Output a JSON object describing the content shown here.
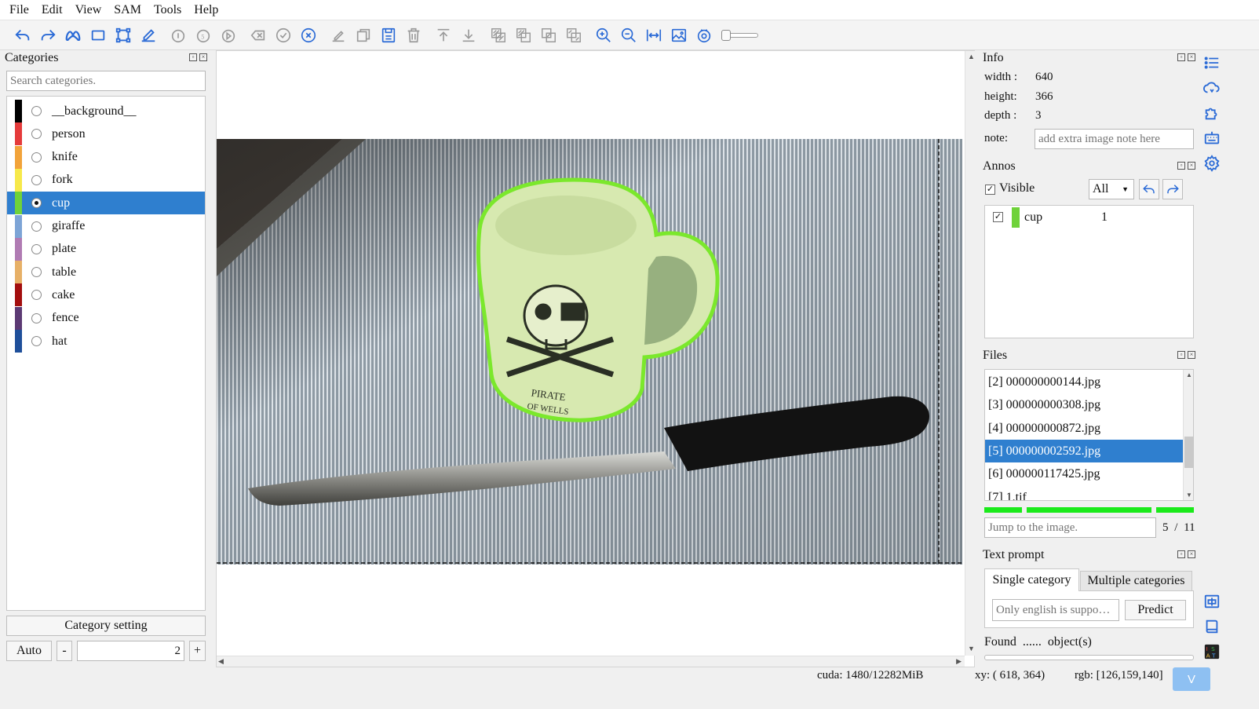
{
  "menu": [
    "File",
    "Edit",
    "View",
    "SAM",
    "Tools",
    "Help"
  ],
  "toolbar": {
    "icons": [
      "undo-icon",
      "redo-icon",
      "sam-icon",
      "rectangle-icon",
      "polygon-icon",
      "line-icon",
      "rotate-icon",
      "rotate-5-icon",
      "play-icon",
      "clear-icon",
      "finish-icon",
      "cancel-icon",
      "edit-icon",
      "copy-icon",
      "save-icon",
      "delete-icon",
      "move-top-icon",
      "move-bottom-icon",
      "union-icon",
      "subtract-icon",
      "intersect-icon",
      "exclude-icon",
      "zoom-in-icon",
      "zoom-out-icon",
      "fit-width-icon",
      "image-icon",
      "eye-icon"
    ],
    "slider_value": 0
  },
  "categories": {
    "title": "Categories",
    "search_placeholder": "Search categories.",
    "items": [
      {
        "label": "__background__",
        "color": "#000000",
        "selected": false
      },
      {
        "label": "person",
        "color": "#e53b3b",
        "selected": false
      },
      {
        "label": "knife",
        "color": "#f2a33a",
        "selected": false
      },
      {
        "label": "fork",
        "color": "#f7e94a",
        "selected": false
      },
      {
        "label": "cup",
        "color": "#6fd23a",
        "selected": true
      },
      {
        "label": "giraffe",
        "color": "#7da4d6",
        "selected": false
      },
      {
        "label": "plate",
        "color": "#b07bb3",
        "selected": false
      },
      {
        "label": "table",
        "color": "#e7b067",
        "selected": false
      },
      {
        "label": "cake",
        "color": "#a30e0e",
        "selected": false
      },
      {
        "label": "fence",
        "color": "#5c3a74",
        "selected": false
      },
      {
        "label": "hat",
        "color": "#1f4f9a",
        "selected": false
      }
    ],
    "setting_label": "Category setting",
    "auto_label": "Auto",
    "minus_label": "-",
    "plus_label": "+",
    "width_value": "2"
  },
  "info": {
    "title": "Info",
    "width_label": "width :",
    "width_value": "640",
    "height_label": "height:",
    "height_value": "366",
    "depth_label": "depth :",
    "depth_value": "3",
    "note_label": "note:",
    "note_placeholder": "add extra image note here"
  },
  "annos": {
    "title": "Annos",
    "visible_label": "Visible",
    "filter_value": "All",
    "items": [
      {
        "label": "cup",
        "color": "#6fd23a",
        "group": "1",
        "checked": true
      }
    ]
  },
  "files": {
    "title": "Files",
    "items": [
      "[2] 000000000144.jpg",
      "[3] 000000000308.jpg",
      "[4] 000000000872.jpg",
      "[5] 000000002592.jpg",
      "[6] 000000117425.jpg",
      "[7] 1.tif"
    ],
    "selected_index": 3,
    "jump_placeholder": "Jump to the image.",
    "current": "5",
    "separator": "/",
    "total": "11"
  },
  "text_prompt": {
    "title": "Text prompt",
    "tabs": [
      "Single category",
      "Multiple categories"
    ],
    "active_tab": 0,
    "input_placeholder": "Only english is suppo…",
    "predict_label": "Predict",
    "found_text": "Found  ......  object(s)"
  },
  "status": {
    "cuda": "cuda: 1480/12282MiB",
    "xy": "xy: ( 618, 364)",
    "rgb": "rgb: [126,159,140]",
    "version_button": "V"
  },
  "colors": {
    "accent": "#2a6ad6",
    "selection": "#2f7fcf",
    "progress": "#1aea1a",
    "mask_outline": "#7be82c"
  }
}
